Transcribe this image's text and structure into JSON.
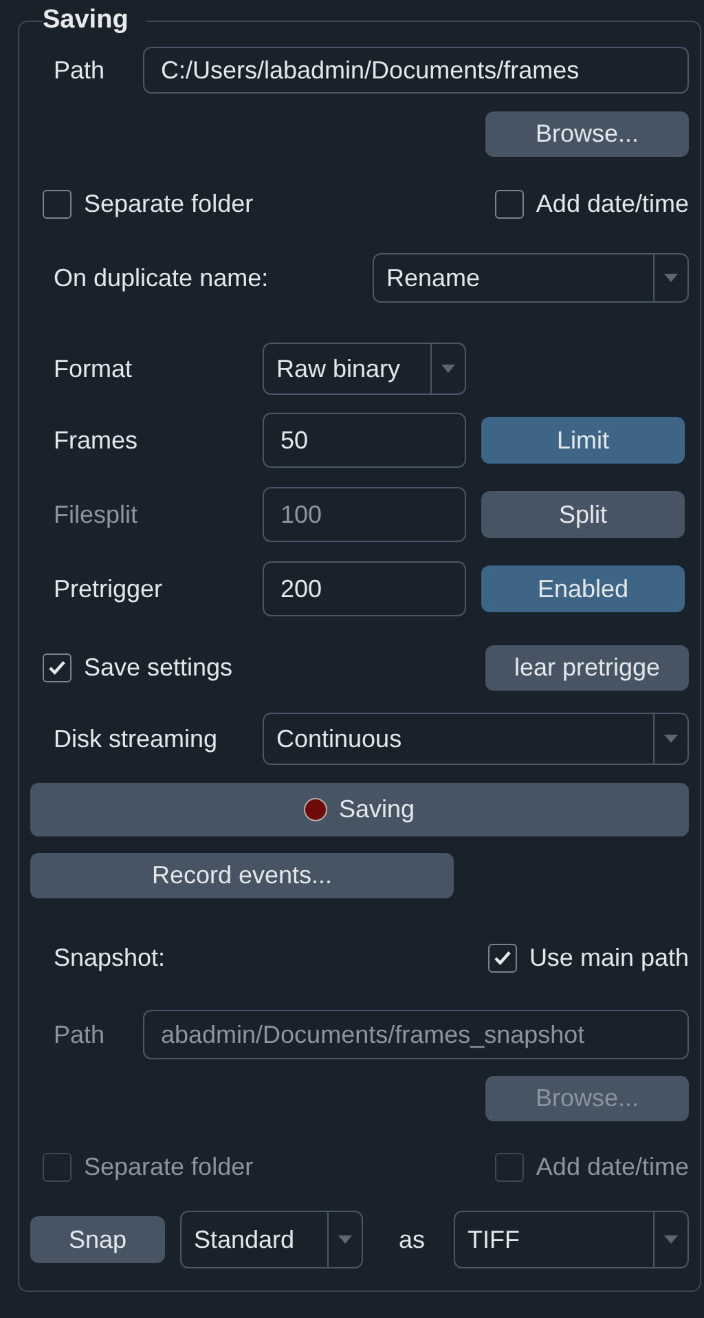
{
  "group": {
    "title": "Saving"
  },
  "path": {
    "label": "Path",
    "value": "C:/Users/labadmin/Documents/frames",
    "disabled": false
  },
  "browse": {
    "label": "Browse...",
    "disabled": false
  },
  "options": [
    {
      "label": "Separate folder",
      "checked": false,
      "disabled": false
    },
    {
      "label": "Add date/time",
      "checked": false,
      "disabled": false
    }
  ],
  "duplicate": {
    "label": "On duplicate name:",
    "value": "Rename"
  },
  "format": {
    "label": "Format",
    "value": "Raw binary"
  },
  "counters": [
    {
      "label": "Frames",
      "value": "50",
      "button": "Limit",
      "on": true,
      "disabled": false
    },
    {
      "label": "Filesplit",
      "value": "100",
      "button": "Split",
      "on": false,
      "disabled": true
    },
    {
      "label": "Pretrigger",
      "value": "200",
      "button": "Enabled",
      "on": true,
      "disabled": false
    }
  ],
  "save_settings": {
    "label": "Save settings",
    "checked": true
  },
  "clear_button": {
    "label": "lear pretrigge"
  },
  "disk_streaming": {
    "label": "Disk streaming",
    "value": "Continuous"
  },
  "saving_button": {
    "label": "Saving",
    "recording": true
  },
  "record_events": {
    "label": "Record events..."
  },
  "snapshot": {
    "label": "Snapshot:",
    "use_main_path": {
      "label": "Use main path",
      "checked": true
    },
    "path": {
      "label": "Path",
      "value": "abadmin/Documents/frames_snapshot",
      "disabled": true
    },
    "browse": {
      "label": "Browse...",
      "disabled": true
    },
    "options": [
      {
        "label": "Separate folder",
        "checked": false,
        "disabled": true
      },
      {
        "label": "Add date/time",
        "checked": false,
        "disabled": true
      }
    ],
    "snap_button": {
      "label": "Snap"
    },
    "mode": {
      "value": "Standard"
    },
    "as_label": "as",
    "file_type": {
      "value": "TIFF"
    }
  }
}
